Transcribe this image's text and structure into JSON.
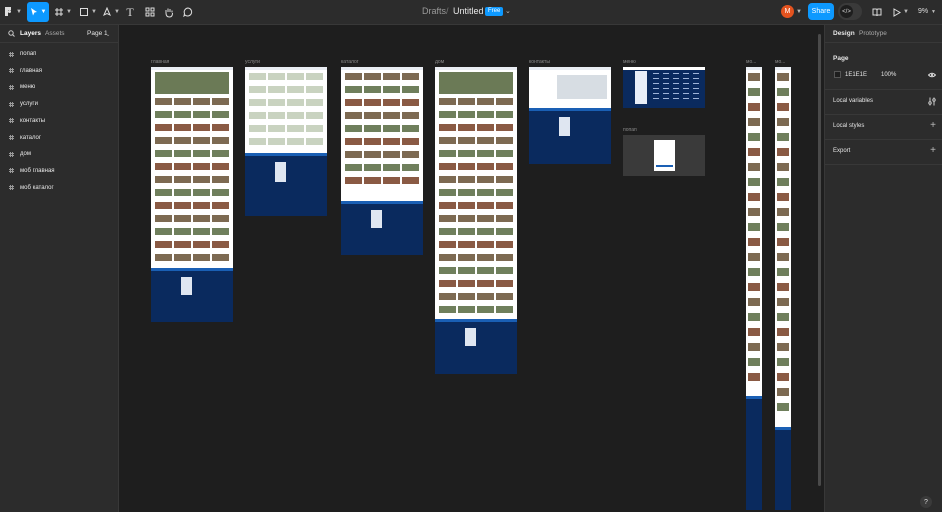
{
  "toolbar": {
    "crumb_drafts": "Drafts",
    "crumb_sep": "/",
    "file_name": "Untitled",
    "plan_badge": "Free",
    "avatar_initial": "M",
    "share_label": "Share",
    "zoom": "9%",
    "icons": [
      "figma-menu-icon",
      "move-tool-icon",
      "frame-tool-icon",
      "shape-tool-icon",
      "pen-tool-icon",
      "text-tool-icon",
      "resources-icon",
      "hand-tool-icon",
      "comment-icon",
      "library-icon",
      "present-icon"
    ]
  },
  "left_panel": {
    "tab_layers": "Layers",
    "tab_assets": "Assets",
    "page_name": "Page 1",
    "layers": [
      "попап",
      "главная",
      "меню",
      "услуги",
      "контакты",
      "каталог",
      "дом",
      "моб главная",
      "моб каталог"
    ]
  },
  "right_panel": {
    "tab_design": "Design",
    "tab_prototype": "Prototype",
    "page_heading": "Page",
    "page_color_hex": "1E1E1E",
    "page_opacity": "100%",
    "local_variables": "Local variables",
    "local_styles": "Local styles",
    "export": "Export"
  },
  "canvas": {
    "frames": [
      {
        "label": "главная",
        "kind": "main"
      },
      {
        "label": "услуги",
        "kind": "services"
      },
      {
        "label": "каталог",
        "kind": "catalog"
      },
      {
        "label": "дом",
        "kind": "house"
      },
      {
        "label": "контакты",
        "kind": "contacts"
      },
      {
        "label": "меню",
        "kind": "menu"
      },
      {
        "label": "попап",
        "kind": "popup"
      },
      {
        "label": "мо...",
        "kind": "mobile-main"
      },
      {
        "label": "мо...",
        "kind": "mobile-catalog"
      }
    ]
  },
  "colors": {
    "accent": "#0d99ff",
    "site_blue": "#1a5fb4",
    "site_footer": "#0a2a5e",
    "canvas_bg": "#1e1e1e",
    "panel_bg": "#2c2c2c"
  }
}
